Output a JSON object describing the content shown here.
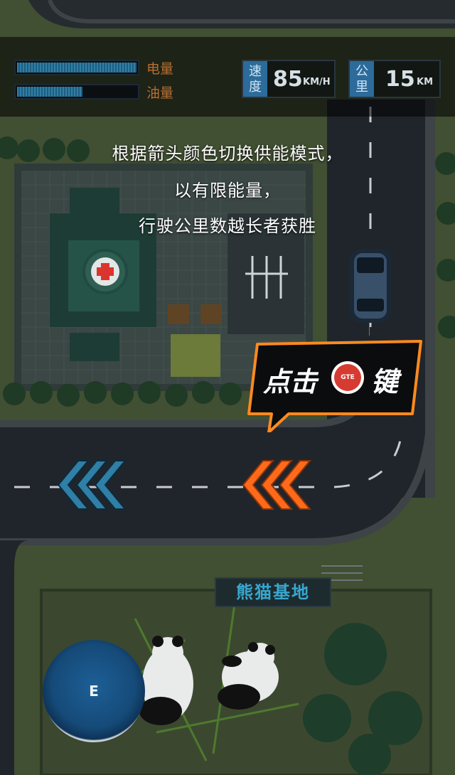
{
  "hud": {
    "battery": {
      "label": "电量",
      "level": 1.0,
      "color": "#2f7fa6"
    },
    "fuel": {
      "label": "油量",
      "level": 0.55,
      "color": "#2f7fa6"
    },
    "speed": {
      "tag": "速度",
      "value": "85",
      "unit": "KM/H"
    },
    "distance": {
      "tag": "公里",
      "value": "15",
      "unit": "KM"
    },
    "label_color": "#b86e33"
  },
  "instructions": [
    "根据箭头颜色切换供能模式，",
    "以有限能量，",
    "行驶公里数越长者获胜"
  ],
  "callout": {
    "text_before": "点击",
    "button_label": "GTE",
    "text_after": "键",
    "border_color": "#ff8a1e"
  },
  "arrows": {
    "left": {
      "icon": "chevron-left-triple-icon",
      "color": "#2f7fa6"
    },
    "right": {
      "icon": "chevron-left-triple-icon",
      "color": "#ff6a1a"
    }
  },
  "map": {
    "sign_label": "熊猫基地",
    "hospital_icon": "medical-cross-icon"
  },
  "e_button": {
    "label": "E"
  }
}
